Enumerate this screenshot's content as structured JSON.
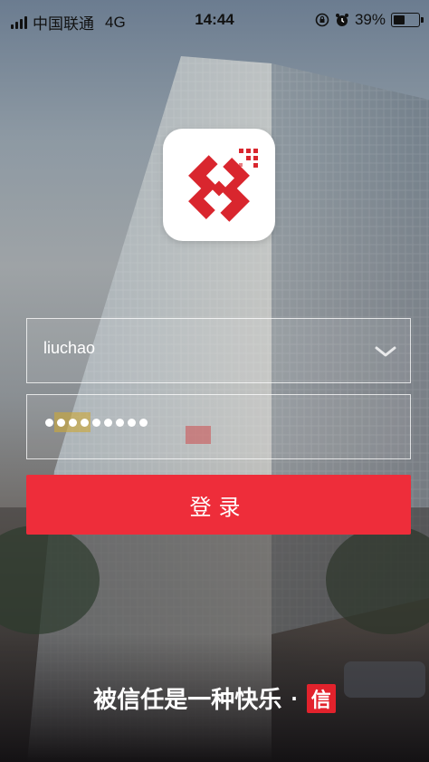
{
  "status_bar": {
    "carrier": "中国联通",
    "network": "4G",
    "time": "14:44",
    "battery_text": "39%",
    "battery_level": 0.39,
    "icons": [
      "signal-icon",
      "rotation-lock-icon",
      "alarm-icon",
      "battery-icon"
    ]
  },
  "login": {
    "username_value": "liuchao",
    "password_length": 9,
    "button_label": "登录"
  },
  "slogan": {
    "text": "被信任是一种快乐",
    "separator": "·",
    "seal_char": "信"
  },
  "colors": {
    "accent": "#ee2d3a",
    "logo_red": "#d9262e",
    "field_border": "#ffffff"
  }
}
